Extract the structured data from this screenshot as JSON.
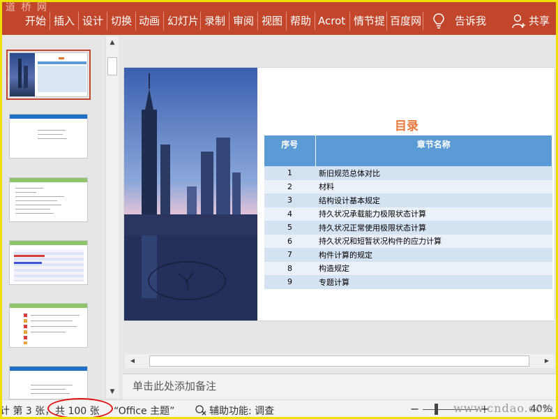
{
  "ribbon": {
    "watermark": "道 桥 网",
    "tabs": [
      "开始",
      "插入",
      "设计",
      "切换",
      "动画",
      "幻灯片",
      "录制",
      "审阅",
      "视图",
      "帮助",
      "Acrot",
      "情节提",
      "百度网"
    ],
    "tell_me": "告诉我",
    "share": "共享"
  },
  "slide": {
    "title": "目录",
    "table": {
      "headers": [
        "序号",
        "章节名称"
      ],
      "rows": [
        {
          "num": "1",
          "name": "新旧规范总体对比"
        },
        {
          "num": "2",
          "name": "材料"
        },
        {
          "num": "3",
          "name": "结构设计基本规定"
        },
        {
          "num": "4",
          "name": "持久状况承载能力极限状态计算"
        },
        {
          "num": "5",
          "name": "持久状况正常使用极限状态计算"
        },
        {
          "num": "6",
          "name": "持久状况和短暂状况构件的应力计算"
        },
        {
          "num": "7",
          "name": "构件计算的规定"
        },
        {
          "num": "8",
          "name": "构造规定"
        },
        {
          "num": "9",
          "name": "专题计算"
        }
      ]
    }
  },
  "notes": {
    "placeholder": "单击此处添加备注"
  },
  "status": {
    "slide_info_prefix": "计 第 3 张，",
    "slide_total": "共 100 张",
    "theme": "“Office 主题”",
    "accessibility": "辅助功能: 调查",
    "zoom_minus": "−",
    "zoom_plus": "+",
    "zoom": "40%",
    "watermark": "www.cndao.com"
  },
  "colors": {
    "ribbon": "#c2462b",
    "table_header": "#5b9bd5",
    "title": "#e9773a",
    "highlight_ellipse": "#e01010"
  }
}
